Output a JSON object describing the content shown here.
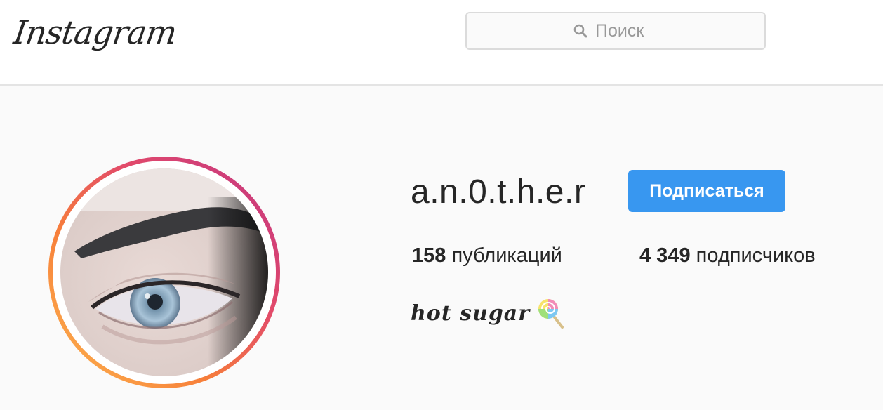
{
  "header": {
    "logo_text": "Instagram",
    "search": {
      "placeholder": "Поиск",
      "value": "",
      "icon": "search-icon"
    }
  },
  "profile": {
    "username": "a.n.0.t.h.e.r",
    "follow_button_label": "Подписаться",
    "stats": {
      "posts_count": "158",
      "posts_label": "публикаций",
      "followers_count": "4 349",
      "followers_label": "подписчиков"
    },
    "bio": {
      "text": "hot sugar",
      "emoji_icon": "lollipop-icon"
    },
    "avatar": {
      "ring_colors": [
        "#f58529",
        "#dd2a7b",
        "#8134af"
      ]
    }
  },
  "colors": {
    "accent": "#3897f0",
    "background": "#fafafa",
    "text": "#262626"
  }
}
